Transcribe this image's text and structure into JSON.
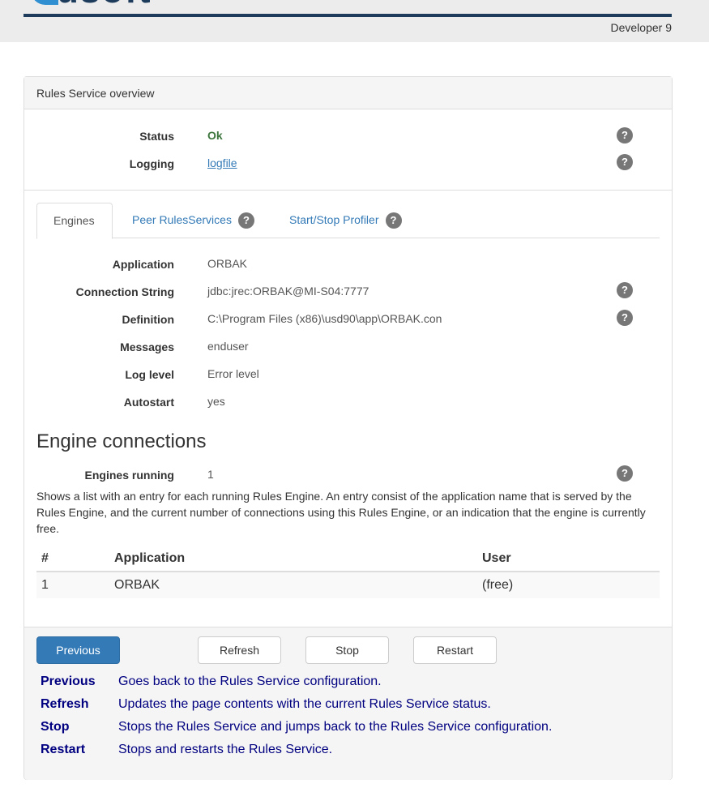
{
  "header": {
    "logo_text": "usoft",
    "user_label": "Developer 9"
  },
  "panel": {
    "title": "Rules Service overview",
    "status": {
      "label": "Status",
      "value": "Ok"
    },
    "logging": {
      "label": "Logging",
      "link_text": "logfile"
    },
    "help_glyph": "?"
  },
  "tabs": [
    {
      "label": "Engines"
    },
    {
      "label": "Peer RulesServices"
    },
    {
      "label": "Start/Stop Profiler"
    }
  ],
  "engine": {
    "application": {
      "label": "Application",
      "value": "ORBAK"
    },
    "connection_string": {
      "label": "Connection String",
      "value": "jdbc:jrec:ORBAK@MI-S04:7777"
    },
    "definition": {
      "label": "Definition",
      "value": "C:\\Program Files (x86)\\usd90\\app\\ORBAK.con"
    },
    "messages": {
      "label": "Messages",
      "value": "enduser"
    },
    "log_level": {
      "label": "Log level",
      "value": "Error level"
    },
    "autostart": {
      "label": "Autostart",
      "value": "yes"
    }
  },
  "connections": {
    "heading": "Engine connections",
    "engines_running": {
      "label": "Engines running",
      "value": "1"
    },
    "description": "Shows a list with an entry for each running Rules Engine. An entry consist of the application name that is served by the Rules Engine, and the current number of connections using this Rules Engine, or an indication that the engine is currently free.",
    "table": {
      "headers": [
        "#",
        "Application",
        "User"
      ],
      "rows": [
        [
          "1",
          "ORBAK",
          "(free)"
        ]
      ]
    }
  },
  "footer": {
    "buttons": {
      "previous": "Previous",
      "refresh": "Refresh",
      "stop": "Stop",
      "restart": "Restart"
    },
    "legend": [
      {
        "key": "Previous",
        "desc": "Goes back to the Rules Service configuration."
      },
      {
        "key": "Refresh",
        "desc": "Updates the page contents with the current Rules Service status."
      },
      {
        "key": "Stop",
        "desc": "Stops the Rules Service and jumps back to the Rules Service configuration."
      },
      {
        "key": "Restart",
        "desc": "Stops and restarts the Rules Service."
      }
    ]
  },
  "colors": {
    "brand_navy": "#1d3c5c",
    "brand_blue": "#2f8fd0",
    "primary_button": "#337ab7",
    "status_ok": "#3c763d",
    "legend_text": "#000080"
  }
}
